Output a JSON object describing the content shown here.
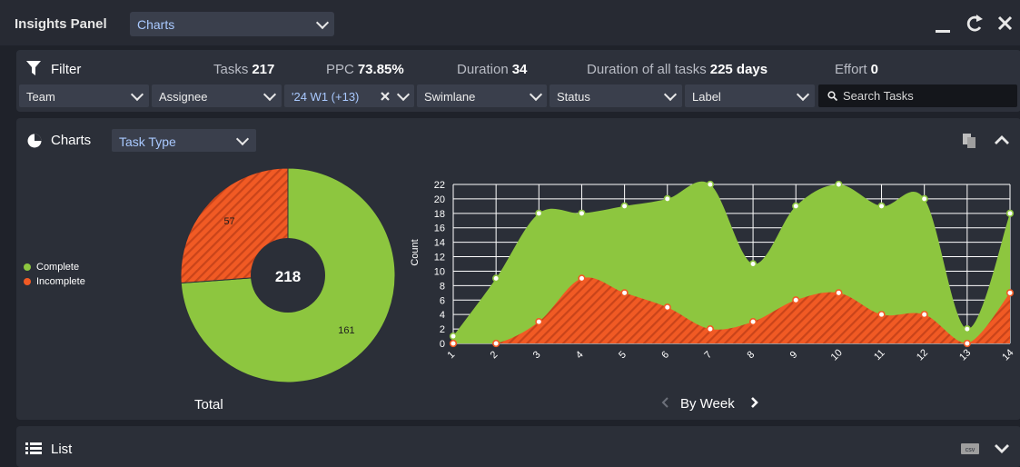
{
  "header": {
    "title": "Insights Panel",
    "panel_select": "Charts"
  },
  "filter": {
    "title": "Filter",
    "stats": [
      {
        "label": "Tasks",
        "value": "217"
      },
      {
        "label": "PPC",
        "value": "73.85%"
      },
      {
        "label": "Duration",
        "value": "34"
      },
      {
        "label": "Duration of all tasks",
        "value": "225 days"
      },
      {
        "label": "Effort",
        "value": "0"
      }
    ],
    "dropdowns": {
      "team": "Team",
      "assignee": "Assignee",
      "week": "'24 W1 (+13)",
      "swimlane": "Swimlane",
      "status": "Status",
      "label": "Label"
    },
    "search_placeholder": "Search Tasks"
  },
  "charts_section": {
    "title": "Charts",
    "type_select": "Task Type",
    "pie_caption": "Total",
    "line_caption": "By Week"
  },
  "list_section": {
    "title": "List",
    "csv_label": "csv"
  },
  "colors": {
    "complete": "#8dc63f",
    "incomplete": "#f15a24"
  },
  "chart_data": [
    {
      "type": "pie",
      "legend": [
        "Complete",
        "Incomplete"
      ],
      "slices": [
        {
          "name": "Complete",
          "value": 161
        },
        {
          "name": "Incomplete",
          "value": 57
        }
      ],
      "center_total": "218",
      "title": "Total"
    },
    {
      "type": "area",
      "x": [
        1,
        2,
        3,
        4,
        5,
        6,
        7,
        8,
        9,
        10,
        11,
        12,
        13,
        14
      ],
      "xlabel": "By Week",
      "ylabel": "Count",
      "ylim": [
        0,
        22
      ],
      "yticks": [
        0,
        2,
        4,
        6,
        8,
        10,
        12,
        14,
        16,
        18,
        20,
        22
      ],
      "grid": true,
      "series": [
        {
          "name": "Complete",
          "values": [
            1,
            9,
            18,
            18,
            19,
            20,
            22,
            11,
            19,
            22,
            19,
            20,
            2,
            18
          ]
        },
        {
          "name": "Incomplete",
          "values": [
            0,
            0,
            3,
            9,
            7,
            5,
            2,
            3,
            6,
            7,
            4,
            4,
            0,
            7
          ]
        }
      ]
    }
  ]
}
